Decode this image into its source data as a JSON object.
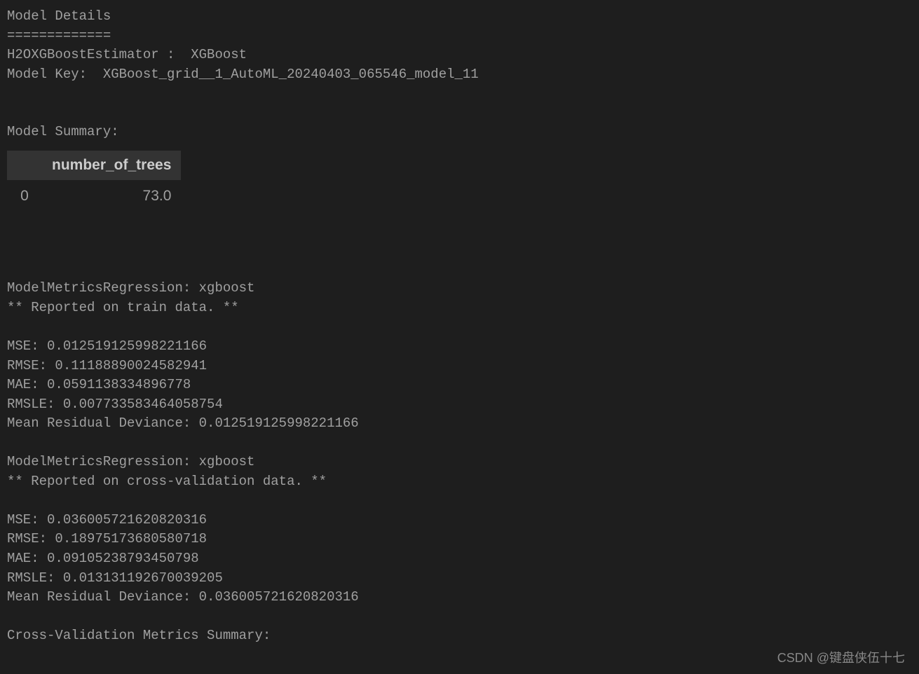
{
  "header": {
    "title": "Model Details",
    "divider": "=============",
    "estimator_line": "H2OXGBoostEstimator :  XGBoost",
    "model_key_line": "Model Key:  XGBoost_grid__1_AutoML_20240403_065546_model_11"
  },
  "summary": {
    "heading": "Model Summary: ",
    "table": {
      "columns": [
        "number_of_trees"
      ],
      "rows": [
        {
          "idx": "0",
          "number_of_trees": "73.0"
        }
      ]
    }
  },
  "train_metrics": {
    "heading": "ModelMetricsRegression: xgboost",
    "note": "** Reported on train data. **",
    "mse": "MSE: 0.012519125998221166",
    "rmse": "RMSE: 0.11188890024582941",
    "mae": "MAE: 0.0591138334896778",
    "rmsle": "RMSLE: 0.007733583464058754",
    "mrd": "Mean Residual Deviance: 0.012519125998221166"
  },
  "cv_metrics": {
    "heading": "ModelMetricsRegression: xgboost",
    "note": "** Reported on cross-validation data. **",
    "mse": "MSE: 0.036005721620820316",
    "rmse": "RMSE: 0.18975173680580718",
    "mae": "MAE: 0.09105238793450798",
    "rmsle": "RMSLE: 0.013131192670039205",
    "mrd": "Mean Residual Deviance: 0.036005721620820316"
  },
  "cv_summary_heading": "Cross-Validation Metrics Summary: ",
  "watermark": "CSDN @键盘侠伍十七"
}
